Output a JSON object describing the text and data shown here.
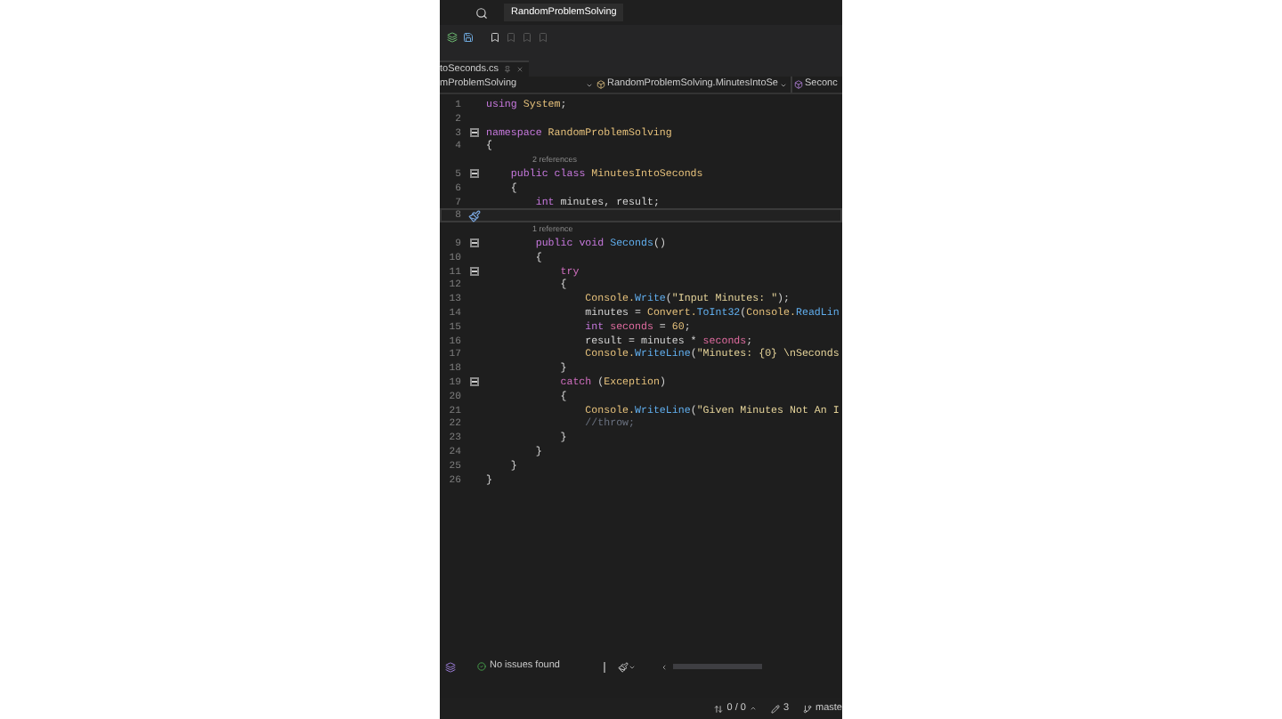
{
  "title_bar": {
    "title": "RandomProblemSolving"
  },
  "tab": {
    "label": "toSeconds.cs",
    "selected": true
  },
  "nav_bar": {
    "project": "mProblemSolving",
    "type": "RandomProblemSolving.MinutesIntoSe",
    "member": "Seconc"
  },
  "editor": {
    "lines": [
      {
        "kind": "code",
        "number": "1",
        "fold": false,
        "current": false,
        "tokens": [
          {
            "text": "using",
            "kind": "keyword"
          },
          {
            "text": " System",
            "kind": "type"
          },
          {
            "text": ";",
            "kind": "plain"
          }
        ]
      },
      {
        "kind": "code",
        "number": "2",
        "fold": false,
        "current": false
      },
      {
        "kind": "code",
        "number": "3",
        "fold": true,
        "current": false,
        "tokens": [
          {
            "text": "namespace",
            "kind": "keyword"
          },
          {
            "text": " RandomProblemSolving",
            "kind": "type"
          }
        ]
      },
      {
        "kind": "code",
        "number": "4",
        "fold": false,
        "current": false,
        "tokens": [
          {
            "text": "{",
            "kind": "plain"
          }
        ]
      },
      {
        "kind": "codelens",
        "text": "2 references"
      },
      {
        "kind": "code",
        "number": "5",
        "fold": true,
        "current": false,
        "tokens": [
          {
            "text": "    public class",
            "kind": "keyword"
          },
          {
            "text": " MinutesIntoSeconds",
            "kind": "type"
          }
        ]
      },
      {
        "kind": "code",
        "number": "6",
        "fold": false,
        "current": false,
        "tokens": [
          {
            "text": "    {",
            "kind": "plain"
          }
        ]
      },
      {
        "kind": "code",
        "number": "7",
        "fold": false,
        "current": false,
        "tokens": [
          {
            "text": "        int",
            "kind": "keyword"
          },
          {
            "text": " minutes, result;",
            "kind": "plain"
          }
        ]
      },
      {
        "kind": "code",
        "number": "8",
        "fold": false,
        "current": true
      },
      {
        "kind": "codelens",
        "text": "1 reference"
      },
      {
        "kind": "code",
        "number": "9",
        "fold": true,
        "current": false,
        "tokens": [
          {
            "text": "        public void",
            "kind": "keyword"
          },
          {
            "text": " Seconds",
            "kind": "method"
          },
          {
            "text": "()",
            "kind": "plain"
          }
        ]
      },
      {
        "kind": "code",
        "number": "10",
        "fold": false,
        "current": false,
        "tokens": [
          {
            "text": "        {",
            "kind": "plain"
          }
        ]
      },
      {
        "kind": "code",
        "number": "11",
        "fold": true,
        "current": false,
        "tokens": [
          {
            "text": "            try",
            "kind": "control"
          }
        ]
      },
      {
        "kind": "code",
        "number": "12",
        "fold": false,
        "current": false,
        "tokens": [
          {
            "text": "            {",
            "kind": "plain"
          }
        ]
      },
      {
        "kind": "code",
        "number": "13",
        "fold": false,
        "current": false,
        "tokens": [
          {
            "text": "                Console.",
            "kind": "type"
          },
          {
            "text": "Write",
            "kind": "method"
          },
          {
            "text": "(",
            "kind": "plain"
          },
          {
            "text": "\"Input Minutes: \"",
            "kind": "string"
          },
          {
            "text": ");",
            "kind": "plain"
          }
        ]
      },
      {
        "kind": "code",
        "number": "14",
        "fold": false,
        "current": false,
        "tokens": [
          {
            "text": "                minutes = ",
            "kind": "plain"
          },
          {
            "text": "Convert.",
            "kind": "type"
          },
          {
            "text": "ToInt32",
            "kind": "method"
          },
          {
            "text": "(",
            "kind": "plain"
          },
          {
            "text": "Console.",
            "kind": "type"
          },
          {
            "text": "ReadLin",
            "kind": "method"
          }
        ]
      },
      {
        "kind": "code",
        "number": "15",
        "fold": false,
        "current": false,
        "tokens": [
          {
            "text": "                int",
            "kind": "keyword"
          },
          {
            "text": " seconds",
            "kind": "local"
          },
          {
            "text": " = ",
            "kind": "plain"
          },
          {
            "text": "60",
            "kind": "number"
          },
          {
            "text": ";",
            "kind": "plain"
          }
        ]
      },
      {
        "kind": "code",
        "number": "16",
        "fold": false,
        "current": false,
        "tokens": [
          {
            "text": "                result = minutes * ",
            "kind": "plain"
          },
          {
            "text": "seconds",
            "kind": "local"
          },
          {
            "text": ";",
            "kind": "plain"
          }
        ]
      },
      {
        "kind": "code",
        "number": "17",
        "fold": false,
        "current": false,
        "tokens": [
          {
            "text": "                Console.",
            "kind": "type"
          },
          {
            "text": "WriteLine",
            "kind": "method"
          },
          {
            "text": "(",
            "kind": "plain"
          },
          {
            "text": "\"Minutes: {0} \\nSeconds",
            "kind": "string"
          }
        ]
      },
      {
        "kind": "code",
        "number": "18",
        "fold": false,
        "current": false,
        "tokens": [
          {
            "text": "            }",
            "kind": "plain"
          }
        ]
      },
      {
        "kind": "code",
        "number": "19",
        "fold": true,
        "current": false,
        "tokens": [
          {
            "text": "            catch",
            "kind": "control"
          },
          {
            "text": " (",
            "kind": "plain"
          },
          {
            "text": "Exception",
            "kind": "type"
          },
          {
            "text": ")",
            "kind": "plain"
          }
        ]
      },
      {
        "kind": "code",
        "number": "20",
        "fold": false,
        "current": false,
        "tokens": [
          {
            "text": "            {",
            "kind": "plain"
          }
        ]
      },
      {
        "kind": "code",
        "number": "21",
        "fold": false,
        "current": false,
        "tokens": [
          {
            "text": "                Console.",
            "kind": "type"
          },
          {
            "text": "WriteLine",
            "kind": "method"
          },
          {
            "text": "(",
            "kind": "plain"
          },
          {
            "text": "\"Given Minutes Not An I",
            "kind": "string"
          }
        ]
      },
      {
        "kind": "code",
        "number": "22",
        "fold": false,
        "current": false,
        "tokens": [
          {
            "text": "                //throw;",
            "kind": "comment"
          }
        ]
      },
      {
        "kind": "code",
        "number": "23",
        "fold": false,
        "current": false,
        "tokens": [
          {
            "text": "            }",
            "kind": "plain"
          }
        ]
      },
      {
        "kind": "code",
        "number": "24",
        "fold": false,
        "current": false,
        "tokens": [
          {
            "text": "        }",
            "kind": "plain"
          }
        ]
      },
      {
        "kind": "code",
        "number": "25",
        "fold": false,
        "current": false,
        "tokens": [
          {
            "text": "    }",
            "kind": "plain"
          }
        ]
      },
      {
        "kind": "code",
        "number": "26",
        "fold": false,
        "current": false,
        "tokens": [
          {
            "text": "}",
            "kind": "plain"
          }
        ]
      }
    ]
  },
  "status_bar": {
    "issues": "No issues found"
  },
  "bottom_bar": {
    "changes": "0 / 0",
    "edits": "3",
    "branch": "maste"
  }
}
